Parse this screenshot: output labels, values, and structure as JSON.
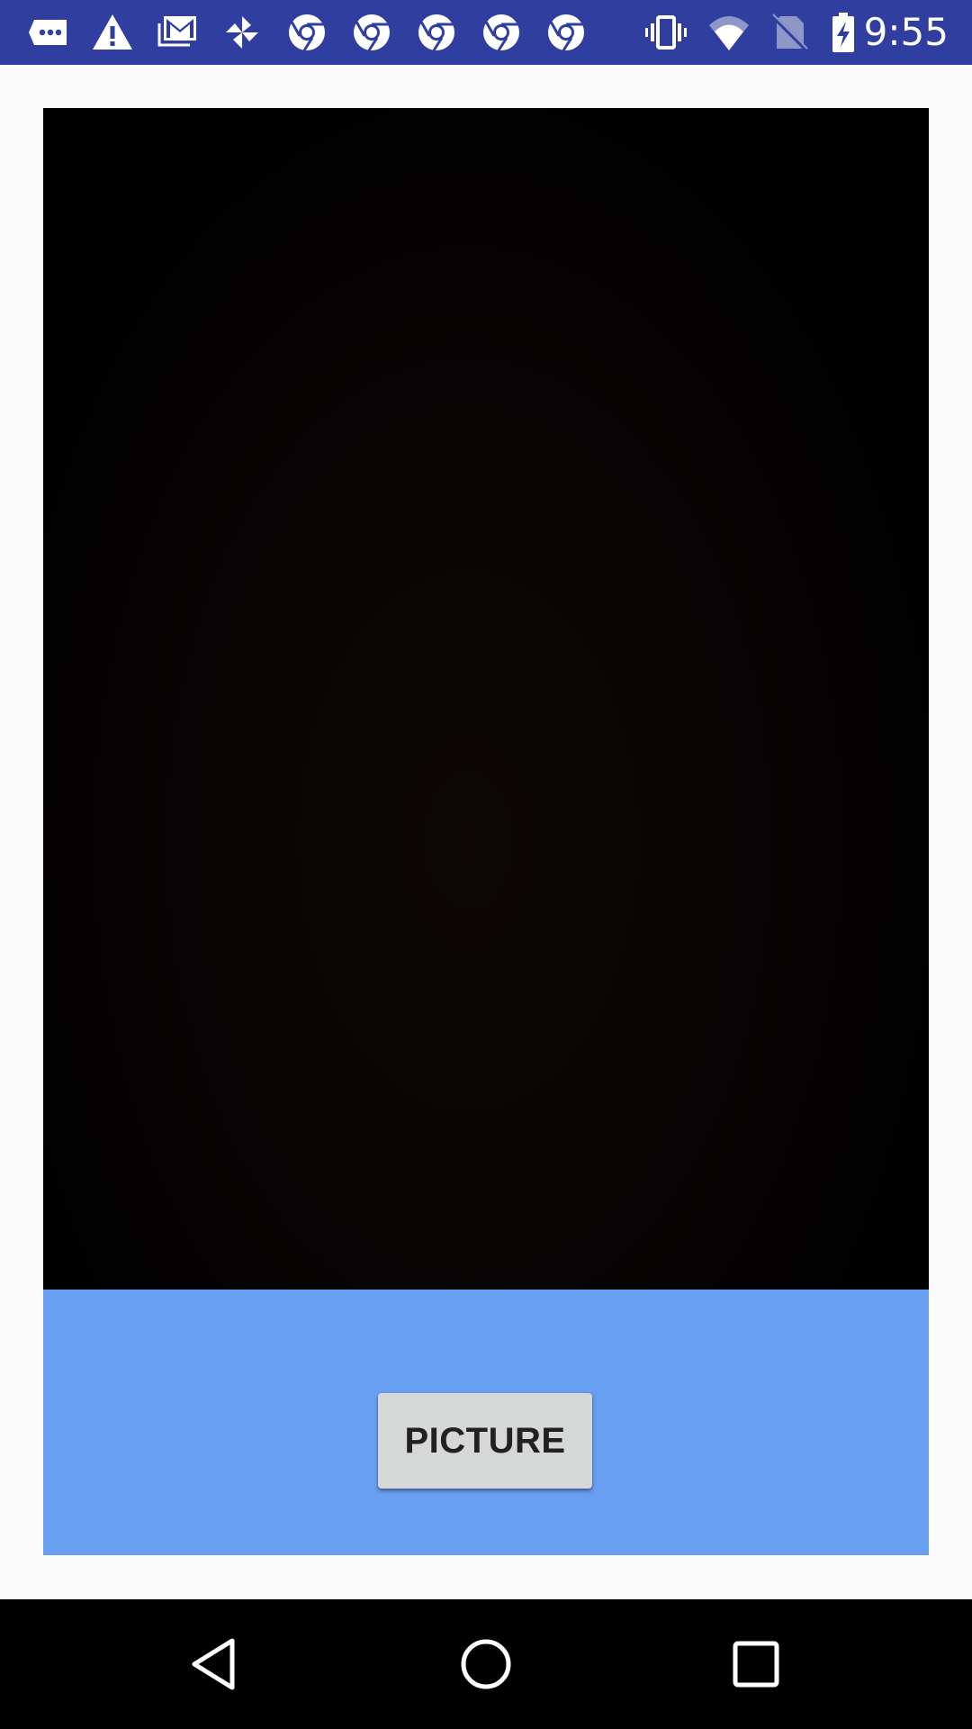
{
  "status_bar": {
    "time": "9:55",
    "notification_icons": [
      "messaging-icon",
      "warning-icon",
      "gmail-icon",
      "pinwheel-icon",
      "chrome-icon",
      "chrome-icon",
      "chrome-icon",
      "chrome-icon",
      "chrome-icon"
    ],
    "system_icons": [
      "vibrate-icon",
      "wifi-icon",
      "no-sim-icon",
      "battery-charging-icon"
    ],
    "background_color": "#303f9f"
  },
  "main": {
    "preview_color": "#000000",
    "control_panel_color": "#689ff1",
    "capture_button_label": "PICTURE",
    "capture_button_color": "#d6d7d7"
  },
  "nav_bar": {
    "buttons": [
      "back-icon",
      "home-icon",
      "recents-icon"
    ]
  }
}
